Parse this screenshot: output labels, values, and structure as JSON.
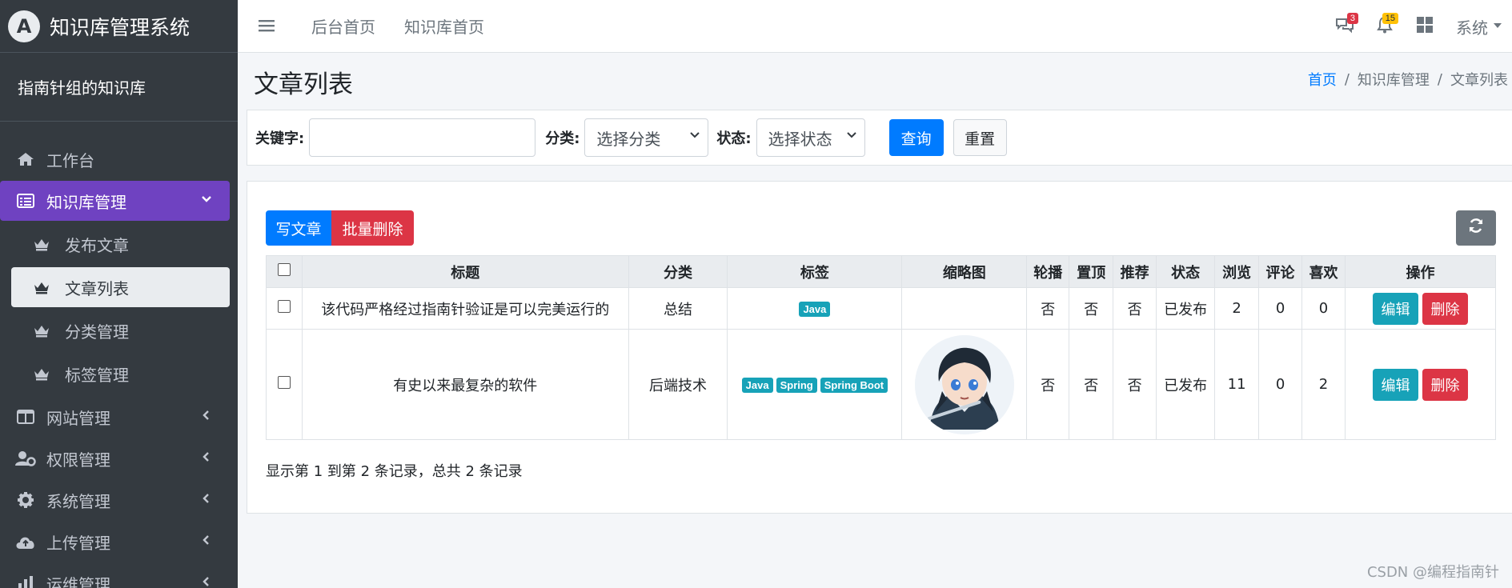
{
  "app": {
    "logo_letter": "A",
    "title": "知识库管理系统",
    "user_panel": "指南针组的知识库"
  },
  "sidebar": {
    "items": [
      {
        "label": "工作台",
        "icon": "home-icon"
      },
      {
        "label": "知识库管理",
        "icon": "list-alt-icon",
        "active": true,
        "expanded": true
      },
      {
        "label": "网站管理",
        "icon": "columns-icon"
      },
      {
        "label": "权限管理",
        "icon": "user-cog-icon"
      },
      {
        "label": "系统管理",
        "icon": "gear-icon"
      },
      {
        "label": "上传管理",
        "icon": "cloud-upload-icon"
      },
      {
        "label": "运维管理",
        "icon": "chart-icon"
      }
    ],
    "subitems": [
      {
        "label": "发布文章",
        "icon": "crown-icon"
      },
      {
        "label": "文章列表",
        "icon": "crown-icon",
        "active": true
      },
      {
        "label": "分类管理",
        "icon": "crown-icon"
      },
      {
        "label": "标签管理",
        "icon": "crown-icon"
      }
    ]
  },
  "topbar": {
    "links": [
      "后台首页",
      "知识库首页"
    ],
    "messages_count": "3",
    "notifications_count": "15",
    "system_menu": "系统"
  },
  "header": {
    "title": "文章列表",
    "breadcrumb": [
      "首页",
      "知识库管理",
      "文章列表"
    ]
  },
  "search": {
    "keyword_label": "关键字:",
    "keyword_value": "",
    "category_label": "分类:",
    "category_selected": "选择分类",
    "status_label": "状态:",
    "status_selected": "选择状态",
    "query_button": "查询",
    "reset_button": "重置"
  },
  "toolbar": {
    "write_button": "写文章",
    "batch_delete_button": "批量删除"
  },
  "table": {
    "columns": [
      "标题",
      "分类",
      "标签",
      "缩略图",
      "轮播",
      "置顶",
      "推荐",
      "状态",
      "浏览",
      "评论",
      "喜欢",
      "操作"
    ],
    "rows": [
      {
        "title": "该代码严格经过指南针验证是可以完美运行的",
        "category": "总结",
        "tags": [
          "Java"
        ],
        "carousel": "否",
        "top": "否",
        "recommend": "否",
        "status": "已发布",
        "views": "2",
        "comments": "0",
        "likes": "0",
        "has_thumbnail": false
      },
      {
        "title": "有史以来最复杂的软件",
        "category": "后端技术",
        "tags": [
          "Java",
          "Spring",
          "Spring Boot"
        ],
        "carousel": "否",
        "top": "否",
        "recommend": "否",
        "status": "已发布",
        "views": "11",
        "comments": "0",
        "likes": "2",
        "has_thumbnail": true
      }
    ],
    "edit_label": "编辑",
    "delete_label": "删除"
  },
  "pager": {
    "info": "显示第 1 到第 2 条记录，总共 2 条记录"
  },
  "watermark": "CSDN @编程指南针",
  "colors": {
    "sidebar_bg": "#343a40",
    "active_nav": "#6f42c1",
    "primary": "#007bff",
    "danger": "#dc3545",
    "info": "#17a2b8"
  }
}
